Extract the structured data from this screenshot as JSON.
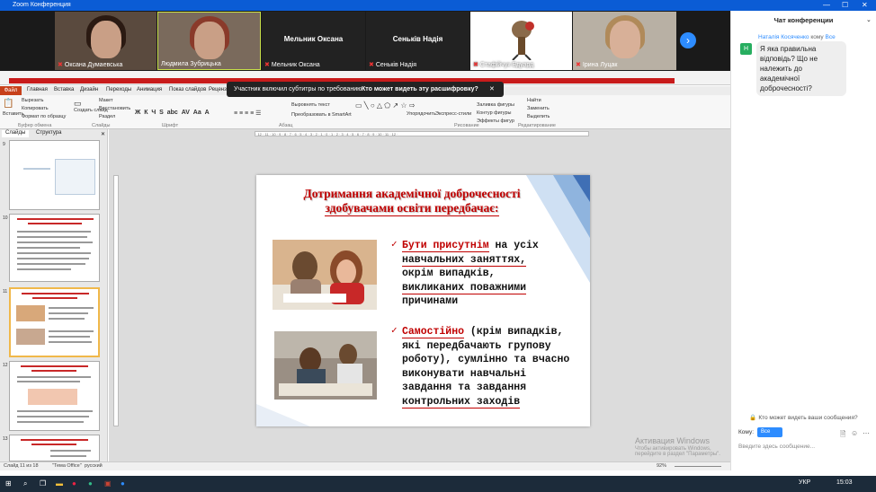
{
  "window": {
    "title": "Zoom Конференция",
    "minimize": "—",
    "maximize": "☐",
    "close": "✕"
  },
  "participants": [
    {
      "name": "Оксана Думаевська",
      "video": true
    },
    {
      "name": "Людмила Зубрицька",
      "video": true
    },
    {
      "name": "Мельник Оксана",
      "video": false,
      "center_label": "Мельник Оксана"
    },
    {
      "name": "Сеньків Надія",
      "video": false,
      "center_label": "Сеньків Надія"
    },
    {
      "name": "Стафійчук Едуард",
      "video": true
    },
    {
      "name": "Ірина Луцак",
      "video": true
    }
  ],
  "caption_banner": {
    "message": "Участник включил субтитры по требованию",
    "question": "Кто может видеть эту расшифровку?",
    "close": "✕"
  },
  "ribbon": {
    "file_tab": "Файл",
    "tabs": [
      "Главная",
      "Вставка",
      "Дизайн",
      "Переходы",
      "Анимация",
      "Показ слайдов",
      "Рецензирование"
    ],
    "groups": {
      "clipboard": {
        "insert": "Вставить",
        "cut": "Вырезать",
        "copy": "Копировать",
        "format": "Формат по образцу",
        "label": "Буфер обмена"
      },
      "slides": {
        "create": "Создать слайд",
        "layout": "Макет",
        "restore": "Восстановить",
        "section": "Раздел",
        "label": "Слайды"
      },
      "font": {
        "label": "Шрифт"
      },
      "paragraph": {
        "label": "Абзац",
        "align": "Выровнять текст",
        "smartart": "Преобразовать в SmartArt"
      },
      "drawing": {
        "arrange": "Упорядочить",
        "styles": "Экспресс-стили",
        "fill": "Заливка фигуры",
        "outline": "Контур фигуры",
        "effects": "Эффекты фигур",
        "label": "Рисование"
      },
      "editing": {
        "find": "Найти",
        "replace": "Заменить",
        "select": "Выделить",
        "label": "Редактирование"
      }
    },
    "panel_tabs": [
      "Слайды",
      "Структура"
    ]
  },
  "ruler_text": "· 12 · 11 · 10 · 9 · 8 · 7 · 6 · 5 · 4 · 3 · 2 · 1 · 0 · 1 · 2 · 3 · 4 · 5 · 6 · 7 · 8 · 9 · 10 · 11 · 12 ·",
  "thumbnails": [
    {
      "number": "9",
      "selected": false
    },
    {
      "number": "10",
      "selected": false
    },
    {
      "number": "11",
      "selected": true
    },
    {
      "number": "12",
      "selected": false
    },
    {
      "number": "13",
      "selected": false
    }
  ],
  "slide": {
    "title_line1": "Дотримання академічної доброчесності",
    "title_line2": "здобувачами  освіти передбачає:",
    "bullet1": {
      "lead": "Бути присутнім",
      "line1_rest": " на усіх",
      "line2": "навчальних заняттях,",
      "line3": "окрім випадків,",
      "line4": "викликаних поважними",
      "line5": "причинами"
    },
    "bullet2": {
      "lead": "Самостійно",
      "line1_rest": " (крім випадків,",
      "line2": "які передбачають групову",
      "line3": "роботу), сумлінно та вчасно",
      "line4": "виконувати навчальні",
      "line5": "завдання та завдання",
      "line6": "контрольних заходів"
    }
  },
  "status": {
    "slide": "Слайд 11 из 18",
    "theme": "\"Тема Office\"",
    "lang": "русский",
    "zoom": "92%"
  },
  "watermark": {
    "line1": "Активация Windows",
    "line2": "Чтобы активировать Windows, перейдите в раздел \"Параметры\"."
  },
  "chat": {
    "title": "Чат конференции",
    "message": {
      "from": "Наталія Косяченко",
      "to_word": "кому",
      "to": "Все",
      "avatar": "Н",
      "text": "Я яка правильна відповідь? Що не належить до академічної доброчесності?"
    },
    "who_can_see": "Кто может видеть ваши сообщения?",
    "to_label": "Кому:",
    "to_value": "Все",
    "input_placeholder": "Введите здесь сообщение..."
  },
  "taskbar": {
    "lang": "УКР",
    "time": "15:03"
  }
}
